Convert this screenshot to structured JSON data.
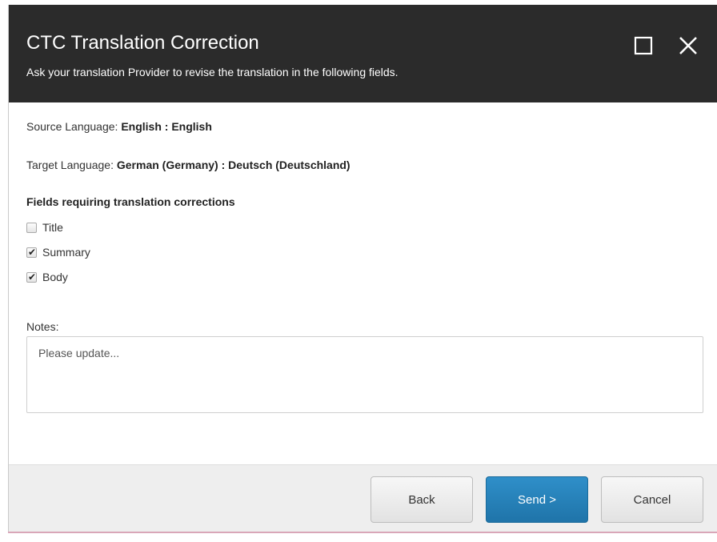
{
  "dialog": {
    "title": "CTC Translation Correction",
    "subtitle": "Ask your translation Provider to revise the translation in the following fields.",
    "maximize_icon": "maximize-icon",
    "close_icon": "close-icon"
  },
  "languages": {
    "source_label": "Source Language: ",
    "source_value": "English : English",
    "target_label": "Target Language: ",
    "target_value": "German (Germany) : Deutsch (Deutschland)"
  },
  "fields": {
    "heading": "Fields requiring translation corrections",
    "items": [
      {
        "label": "Title",
        "checked": false
      },
      {
        "label": "Summary",
        "checked": true
      },
      {
        "label": "Body",
        "checked": true
      }
    ]
  },
  "notes": {
    "label": "Notes:",
    "placeholder": "Please update..."
  },
  "buttons": {
    "back": "Back",
    "send": "Send >",
    "cancel": "Cancel"
  },
  "colors": {
    "titlebar": "#2b2b2b",
    "primary_button": "#2681bb",
    "footer": "#eeeeee"
  }
}
